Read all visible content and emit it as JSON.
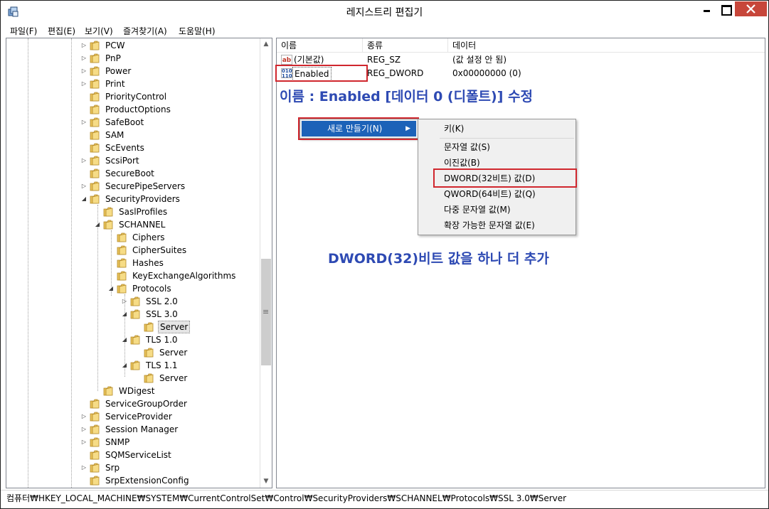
{
  "window": {
    "title": "레지스트리 편집기"
  },
  "menubar": {
    "items": [
      "파일(F)",
      "편집(E)",
      "보기(V)",
      "즐겨찾기(A)",
      "도움말(H)"
    ]
  },
  "tree": {
    "items": [
      {
        "label": "PCW",
        "expander": "collapsed"
      },
      {
        "label": "PnP",
        "expander": "collapsed"
      },
      {
        "label": "Power",
        "expander": "collapsed"
      },
      {
        "label": "Print",
        "expander": "collapsed"
      },
      {
        "label": "PriorityControl",
        "expander": "none"
      },
      {
        "label": "ProductOptions",
        "expander": "none"
      },
      {
        "label": "SafeBoot",
        "expander": "collapsed"
      },
      {
        "label": "SAM",
        "expander": "none"
      },
      {
        "label": "ScEvents",
        "expander": "none"
      },
      {
        "label": "ScsiPort",
        "expander": "collapsed"
      },
      {
        "label": "SecureBoot",
        "expander": "none"
      },
      {
        "label": "SecurePipeServers",
        "expander": "collapsed"
      },
      {
        "label": "SecurityProviders",
        "expander": "expanded"
      },
      {
        "label": "SaslProfiles",
        "expander": "none"
      },
      {
        "label": "SCHANNEL",
        "expander": "expanded"
      },
      {
        "label": "Ciphers",
        "expander": "none"
      },
      {
        "label": "CipherSuites",
        "expander": "none"
      },
      {
        "label": "Hashes",
        "expander": "none"
      },
      {
        "label": "KeyExchangeAlgorithms",
        "expander": "none"
      },
      {
        "label": "Protocols",
        "expander": "expanded"
      },
      {
        "label": "SSL 2.0",
        "expander": "collapsed"
      },
      {
        "label": "SSL 3.0",
        "expander": "expanded"
      },
      {
        "label": "Server",
        "expander": "none",
        "selected": true
      },
      {
        "label": "TLS 1.0",
        "expander": "expanded"
      },
      {
        "label": "Server",
        "expander": "none"
      },
      {
        "label": "TLS 1.1",
        "expander": "expanded"
      },
      {
        "label": "Server",
        "expander": "none"
      },
      {
        "label": "WDigest",
        "expander": "none"
      },
      {
        "label": "ServiceGroupOrder",
        "expander": "none"
      },
      {
        "label": "ServiceProvider",
        "expander": "collapsed"
      },
      {
        "label": "Session Manager",
        "expander": "collapsed"
      },
      {
        "label": "SNMP",
        "expander": "collapsed"
      },
      {
        "label": "SQMServiceList",
        "expander": "none"
      },
      {
        "label": "Srp",
        "expander": "collapsed"
      },
      {
        "label": "SrpExtensionConfig",
        "expander": "none"
      }
    ]
  },
  "list": {
    "columns": [
      "이름",
      "종류",
      "데이터"
    ],
    "rows": [
      {
        "name": "(기본값)",
        "type": "REG_SZ",
        "data": "(값 설정 안 됨)",
        "icon": "string-value-icon"
      },
      {
        "name": "Enabled",
        "type": "REG_DWORD",
        "data": "0x00000000 (0)",
        "icon": "binary-value-icon"
      }
    ]
  },
  "annotations": {
    "top": "이름 : Enabled [데이터 0 (디폴트)] 수정",
    "bottom": "DWORD(32)비트 값을 하나 더 추가"
  },
  "context_menu": {
    "new_item": "새로 만들기(N)",
    "submenu_items": [
      "키(K)",
      "문자열 값(S)",
      "이진값(B)",
      "DWORD(32비트) 값(D)",
      "QWORD(64비트) 값(Q)",
      "다중 문자열 값(M)",
      "확장 가능한 문자열 값(E)"
    ]
  },
  "statusbar": {
    "path": "컴퓨터₩HKEY_LOCAL_MACHINE₩SYSTEM₩CurrentControlSet₩Control₩SecurityProviders₩SCHANNEL₩Protocols₩SSL 3.0₩Server"
  },
  "colors": {
    "highlight_border": "#d0272e",
    "annotation_text": "#2e4ab3",
    "menu_highlight": "#1c62b8",
    "close_button": "#c7463a"
  }
}
